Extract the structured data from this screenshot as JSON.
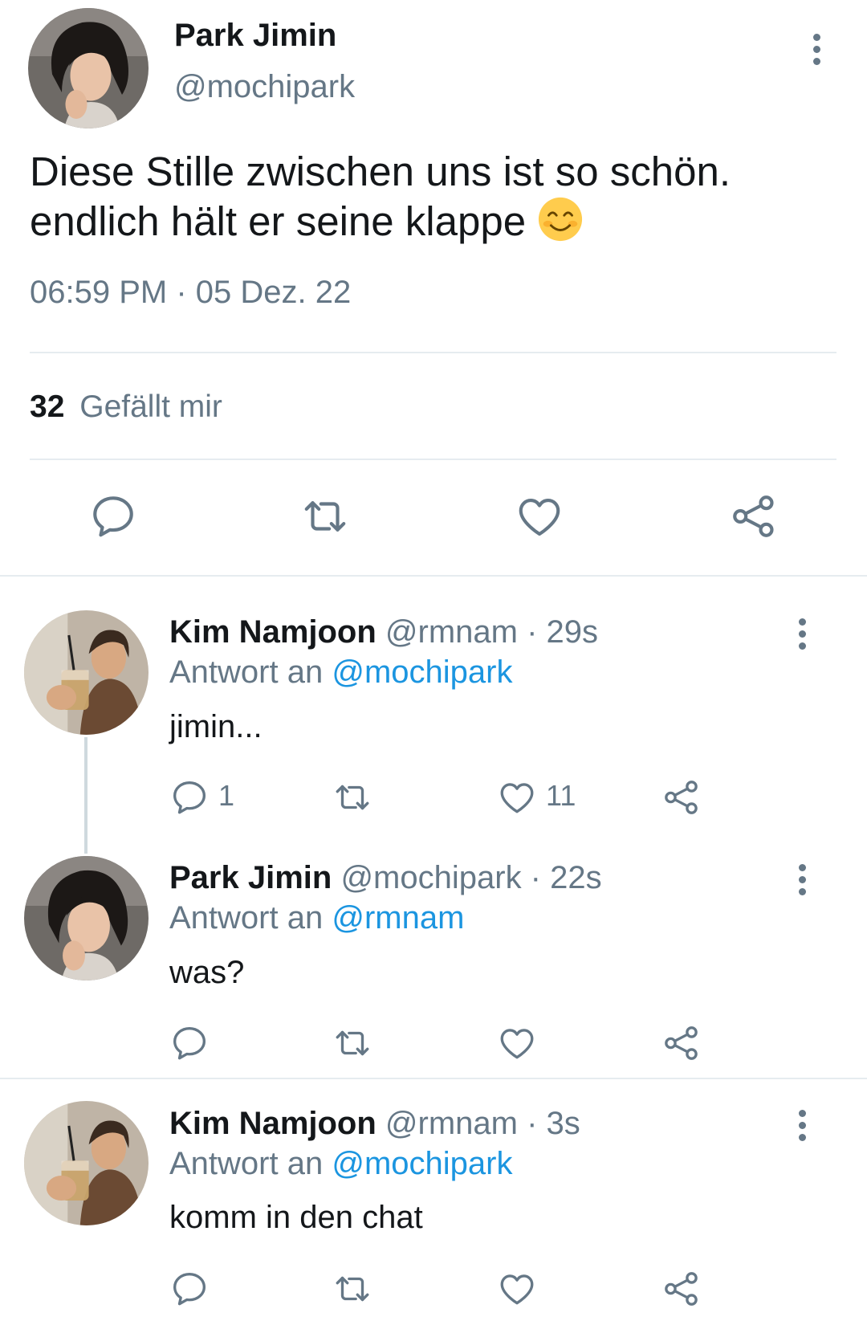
{
  "main_tweet": {
    "author_name": "Park Jimin",
    "handle": "@mochipark",
    "text_line1": "Diese Stille zwischen uns ist so schön.",
    "text_line2": "endlich hält er seine klappe",
    "emoji": "😊",
    "timestamp": "06:59 PM · 05 Dez. 22",
    "likes_count": "32",
    "likes_label": "Gefällt mir"
  },
  "replies": [
    {
      "author_name": "Kim Namjoon",
      "handle_time": "@rmnam · 29s",
      "reply_prefix": "Antwort an",
      "reply_to": "@mochipark",
      "text": "jimin...",
      "reply_count": "1",
      "like_count": "11"
    },
    {
      "author_name": "Park Jimin",
      "handle_time": "@mochipark · 22s",
      "reply_prefix": "Antwort an",
      "reply_to": "@rmnam",
      "text": "was?"
    },
    {
      "author_name": "Kim Namjoon",
      "handle_time": "@rmnam · 3s",
      "reply_prefix": "Antwort an",
      "reply_to": "@mochipark",
      "text": "komm in den chat"
    }
  ],
  "icons": [
    "reply-icon",
    "retweet-icon",
    "like-icon",
    "share-icon",
    "more-icon"
  ],
  "colors": {
    "text": "#14171a",
    "secondary": "#657786",
    "link": "#1b95e0",
    "divider": "#e6ecf0"
  }
}
